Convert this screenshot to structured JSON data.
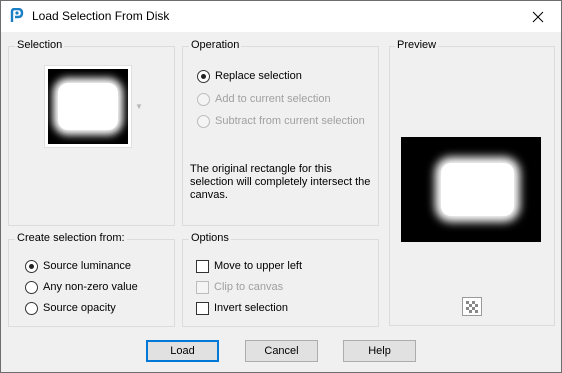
{
  "window": {
    "title": "Load Selection From Disk"
  },
  "selection_group": {
    "title": "Selection"
  },
  "operation_group": {
    "title": "Operation",
    "options": [
      {
        "label": "Replace selection",
        "checked": true,
        "enabled": true
      },
      {
        "label": "Add to current selection",
        "checked": false,
        "enabled": false
      },
      {
        "label": "Subtract from current selection",
        "checked": false,
        "enabled": false
      }
    ],
    "info": "The original rectangle for this selection will completely intersect the canvas."
  },
  "preview_group": {
    "title": "Preview"
  },
  "create_group": {
    "title": "Create selection from:",
    "options": [
      {
        "label": "Source luminance",
        "checked": true
      },
      {
        "label": "Any non-zero value",
        "checked": false
      },
      {
        "label": "Source opacity",
        "checked": false
      }
    ]
  },
  "options_group": {
    "title": "Options",
    "items": [
      {
        "label": "Move to upper left",
        "checked": false,
        "enabled": true
      },
      {
        "label": "Clip to canvas",
        "checked": false,
        "enabled": false
      },
      {
        "label": "Invert selection",
        "checked": false,
        "enabled": true
      }
    ]
  },
  "buttons": {
    "load": "Load",
    "cancel": "Cancel",
    "help": "Help"
  },
  "colors": {
    "accent": "#0078d7",
    "app_icon": "#1a7fc4"
  }
}
